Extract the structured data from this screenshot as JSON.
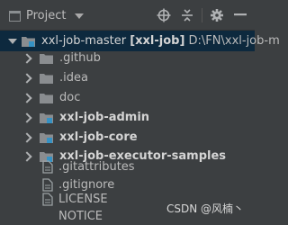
{
  "toolbar": {
    "view_label": "Project",
    "icons": [
      "locate-icon",
      "collapse-all-icon",
      "settings-gear-icon",
      "hide-minus-icon"
    ]
  },
  "tree": {
    "root": {
      "name": "xxl-job-master",
      "module_tag": "[xxl-job]",
      "path": "D:\\FN\\xxl-job-m"
    },
    "items": [
      {
        "label": ".github",
        "type": "folder"
      },
      {
        "label": ".idea",
        "type": "folder"
      },
      {
        "label": "doc",
        "type": "folder"
      },
      {
        "label": "xxl-job-admin",
        "type": "module"
      },
      {
        "label": "xxl-job-core",
        "type": "module"
      },
      {
        "label": "xxl-job-executor-samples",
        "type": "module"
      },
      {
        "label": ".gitattributes",
        "type": "file"
      },
      {
        "label": ".gitignore",
        "type": "file"
      },
      {
        "label": "LICENSE",
        "type": "file"
      },
      {
        "label": "NOTICE",
        "type": "file"
      }
    ]
  },
  "watermark": "CSDN @风楠丶",
  "colors": {
    "background": "#3c3f41",
    "selection": "#0d293e",
    "folder": "#8a8d90",
    "module_marker": "#3592c4",
    "text": "#bbbbbb"
  }
}
